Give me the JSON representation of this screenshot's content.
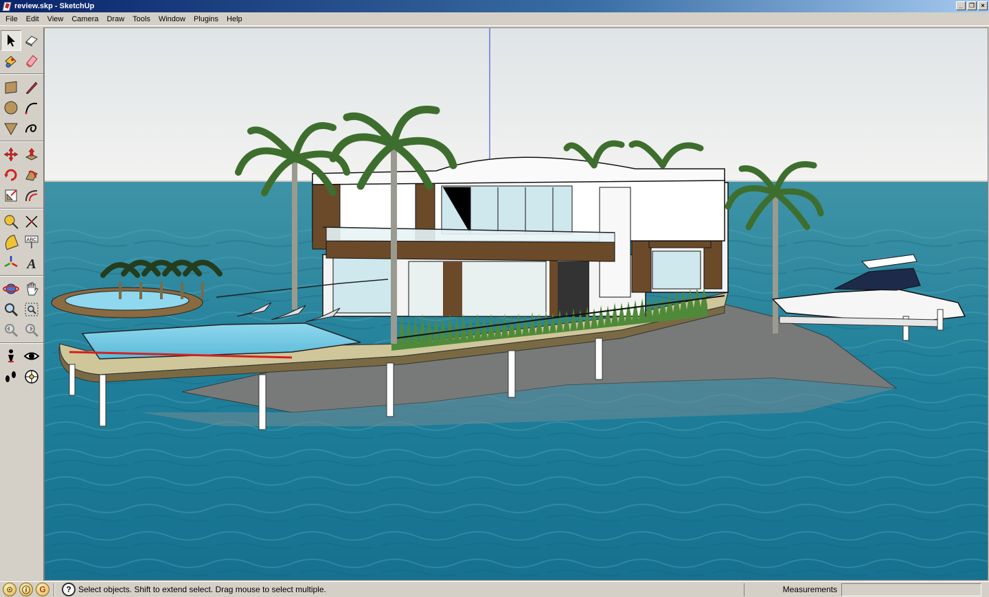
{
  "window": {
    "title": "review.skp - SketchUp",
    "controls": {
      "minimize": "_",
      "restore": "❐",
      "close": "×"
    }
  },
  "menu": [
    "File",
    "Edit",
    "View",
    "Camera",
    "Draw",
    "Tools",
    "Window",
    "Plugins",
    "Help"
  ],
  "toolbar": {
    "groups": [
      [
        [
          "select-tool",
          "make-component-tool"
        ],
        [
          "paint-bucket-tool",
          "eraser-tool"
        ]
      ],
      [
        [
          "rectangle-tool",
          "line-tool"
        ],
        [
          "circle-tool",
          "arc-tool"
        ],
        [
          "polygon-tool",
          "freehand-tool"
        ]
      ],
      [
        [
          "move-tool",
          "push-pull-tool"
        ],
        [
          "rotate-tool",
          "follow-me-tool"
        ],
        [
          "scale-tool",
          "offset-tool"
        ]
      ],
      [
        [
          "tape-measure-tool",
          "dimension-tool"
        ],
        [
          "protractor-tool",
          "text-tool"
        ],
        [
          "axes-tool",
          "3d-text-tool"
        ]
      ],
      [
        [
          "orbit-tool",
          "pan-tool"
        ],
        [
          "zoom-tool",
          "zoom-window-tool"
        ],
        [
          "previous-view-tool",
          "next-view-tool"
        ]
      ],
      [
        [
          "position-camera-tool",
          "look-around-tool"
        ],
        [
          "walk-tool",
          "section-plane-tool"
        ]
      ]
    ],
    "active": "select-tool",
    "labels": {
      "text-tool": "ABC",
      "3d-text-tool": "A"
    }
  },
  "colors": {
    "sky_top": "#dfe4e6",
    "sky_horizon": "#f3f3f1",
    "water_far": "#3f93a6",
    "water_near": "#16718f",
    "deck": "#cfc69a",
    "wood": "#6b4a2a",
    "pool": "#7fd3ea",
    "rock": "#7d7a78",
    "palm": "#4a7a3a",
    "accent_red": "#d42020"
  },
  "statusbar": {
    "geo_icon": "geo-location-icon",
    "credits_icon": "credits-icon",
    "google_icon": "google-signin-icon",
    "help_icon": "?",
    "message": "Select objects. Shift to extend select. Drag mouse to select multiple.",
    "measurements_label": "Measurements",
    "measurements_value": ""
  }
}
